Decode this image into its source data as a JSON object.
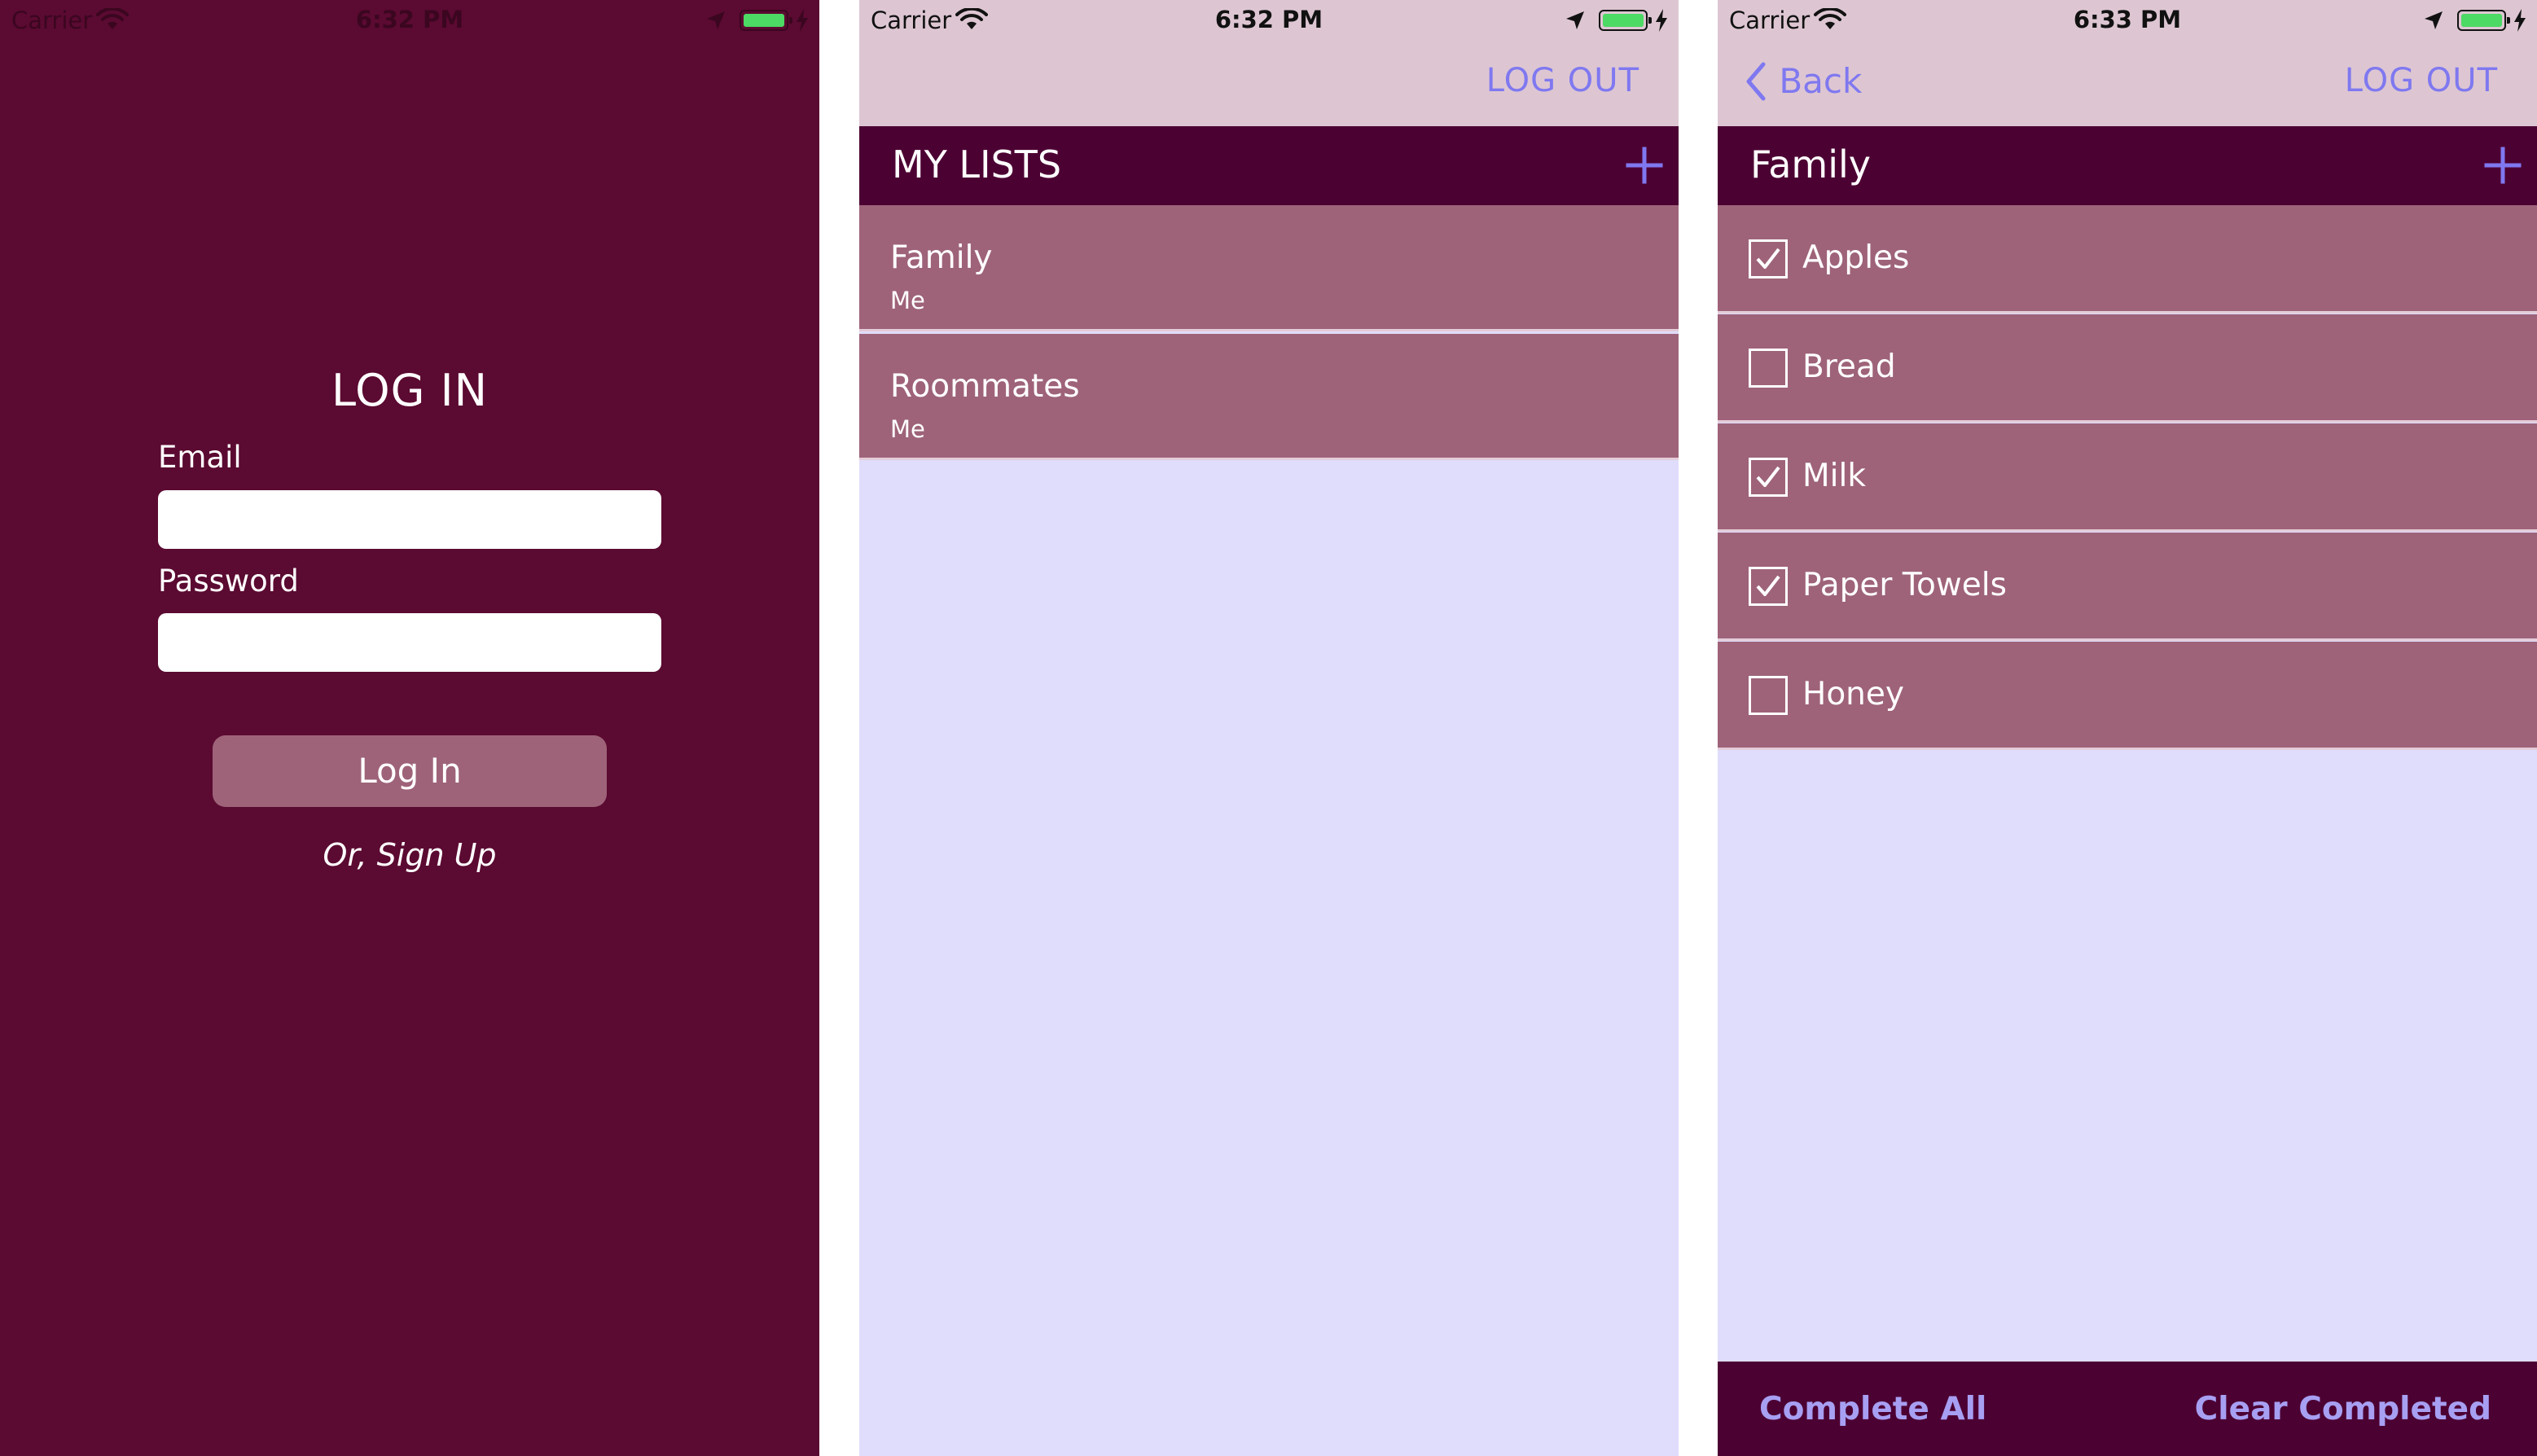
{
  "colors": {
    "login_bg": "#5b0a31",
    "list_bg": "#e0dcfc",
    "nav_bg": "#ddc6d2",
    "header_bg": "#4c0133",
    "row_bg": "#9e6379",
    "accent": "#7f78f0",
    "toolbar_text": "#a79ff2",
    "battery": "#4cd964"
  },
  "screens": [
    {
      "status": {
        "carrier": "Carrier",
        "time": "6:32 PM"
      },
      "login": {
        "title": "LOG IN",
        "email_label": "Email",
        "email_value": "",
        "password_label": "Password",
        "password_value": "",
        "login_button": "Log In",
        "signup_link": "Or, Sign Up"
      }
    },
    {
      "status": {
        "carrier": "Carrier",
        "time": "6:32 PM"
      },
      "nav": {
        "logout": "LOG OUT"
      },
      "header": {
        "title": "MY LISTS"
      },
      "lists": [
        {
          "name": "Family",
          "owner": "Me"
        },
        {
          "name": "Roommates",
          "owner": "Me"
        }
      ]
    },
    {
      "status": {
        "carrier": "Carrier",
        "time": "6:33 PM"
      },
      "nav": {
        "back": "Back",
        "logout": "LOG OUT"
      },
      "header": {
        "title": "Family"
      },
      "items": [
        {
          "name": "Apples",
          "checked": true
        },
        {
          "name": "Bread",
          "checked": false
        },
        {
          "name": "Milk",
          "checked": true
        },
        {
          "name": "Paper Towels",
          "checked": true
        },
        {
          "name": "Honey",
          "checked": false
        }
      ],
      "toolbar": {
        "complete_all": "Complete All",
        "clear_completed": "Clear Completed"
      }
    }
  ]
}
